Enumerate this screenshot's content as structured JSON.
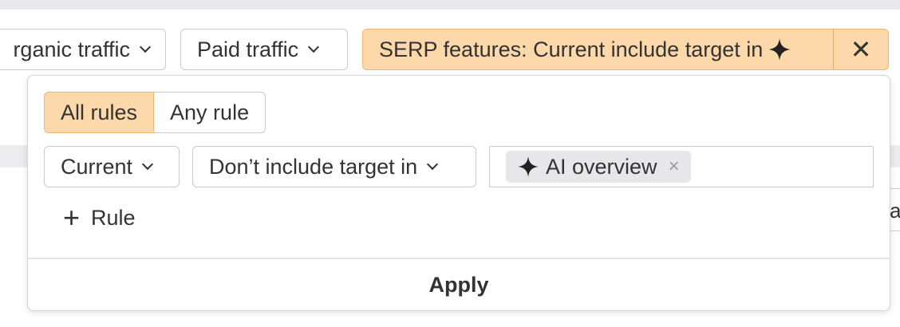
{
  "filter_bar": {
    "organic_label": "rganic traffic",
    "paid_label": "Paid traffic",
    "serp_label": "SERP features: Current include target in",
    "serp_close": "✕"
  },
  "background": {
    "right_peek_text": "a"
  },
  "popover": {
    "match_tabs": [
      {
        "label": "All rules",
        "active": true
      },
      {
        "label": "Any rule",
        "active": false
      }
    ],
    "rule": {
      "field_select": "Current",
      "condition_select": "Don’t include target in",
      "tags": [
        {
          "label": "AI overview",
          "remove": "×"
        }
      ]
    },
    "add_rule": {
      "plus": "+",
      "label": "Rule"
    },
    "apply_label": "Apply"
  },
  "colors": {
    "active_bg": "#fcd8ab",
    "active_border": "#f1b772",
    "tag_bg": "#e7e7ea",
    "text": "#333333"
  }
}
